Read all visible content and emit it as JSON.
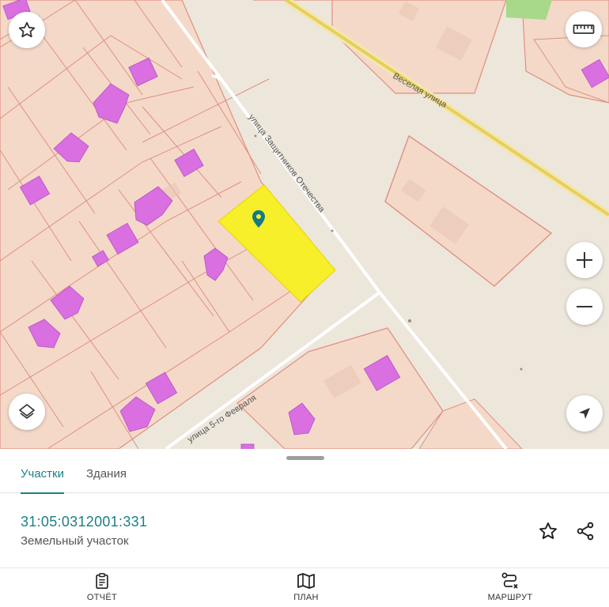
{
  "map": {
    "streets": {
      "vesyolaya": "Веселая улица",
      "zashchitnikov": "улица Защитников Отечества",
      "fevralya": "улица 5-го Февраля"
    },
    "selected_parcel_color": "#f7ef2a",
    "building_color": "#d96fe0",
    "parcel_fill": "#f4d9c9",
    "parcel_border": "#e08f80",
    "road_color": "#e7cf5a",
    "marker_color": "#137a86"
  },
  "controls": {
    "favorite_icon": "star-icon",
    "ruler_icon": "ruler-icon",
    "zoom_in_icon": "plus-icon",
    "zoom_out_icon": "minus-icon",
    "layers_icon": "layers-icon",
    "locate_icon": "navigation-arrow-icon"
  },
  "sheet": {
    "tabs": [
      "Участки",
      "Здания"
    ],
    "active_tab": "Участки",
    "parcel": {
      "cadastral_number": "31:05:0312001:331",
      "type": "Земельный участок"
    }
  },
  "bottom_nav": [
    {
      "label": "ОТЧЁТ",
      "icon": "clipboard-icon"
    },
    {
      "label": "ПЛАН",
      "icon": "map-icon"
    },
    {
      "label": "МАРШРУТ",
      "icon": "route-icon"
    }
  ],
  "accent_color": "#1d7f86"
}
